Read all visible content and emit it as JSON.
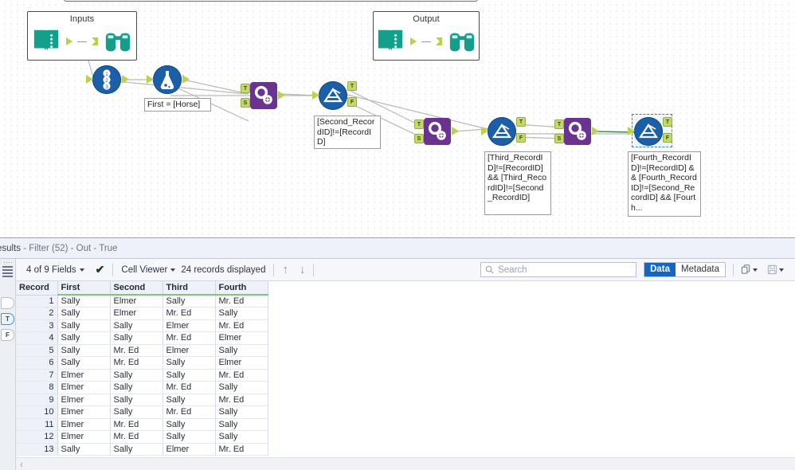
{
  "canvas": {
    "containers": [
      {
        "title": "Inputs"
      },
      {
        "title": "Output"
      }
    ],
    "expressions": [
      "First = [Horse]",
      "[Second_RecordID]!=[RecordID]",
      "[Third_RecordID]!=[RecordID] && [Third_RecordID]!=[Second_RecordID]",
      "[Fourth_RecordID]!=[RecordID] && [Fourth_RecordID]!=[Second_RecordID] && [Fourth..."
    ],
    "anchors": {
      "true": "T",
      "false": "F",
      "source": "S"
    }
  },
  "results": {
    "title_prefix": "esults",
    "title_rest": " - Filter (52) - Out - True",
    "toolbar": {
      "fields": "4 of 9 Fields",
      "cell_viewer": "Cell Viewer",
      "records": "24 records displayed",
      "search_placeholder": "Search",
      "data_label": "Data",
      "metadata_label": "Metadata",
      "up_arrow": "↑",
      "down_arrow": "↓",
      "check": "✔"
    },
    "rail": {
      "true_tab": "T",
      "false_tab": "F"
    },
    "table": {
      "columns": [
        "Record",
        "First",
        "Second",
        "Third",
        "Fourth"
      ],
      "rows": [
        [
          "1",
          "Sally",
          "Elmer",
          "Sally",
          "Mr. Ed"
        ],
        [
          "2",
          "Sally",
          "Elmer",
          "Mr. Ed",
          "Sally"
        ],
        [
          "3",
          "Sally",
          "Sally",
          "Elmer",
          "Mr. Ed"
        ],
        [
          "4",
          "Sally",
          "Sally",
          "Mr. Ed",
          "Elmer"
        ],
        [
          "5",
          "Sally",
          "Mr. Ed",
          "Elmer",
          "Sally"
        ],
        [
          "6",
          "Sally",
          "Mr. Ed",
          "Sally",
          "Elmer"
        ],
        [
          "7",
          "Elmer",
          "Sally",
          "Sally",
          "Mr. Ed"
        ],
        [
          "8",
          "Elmer",
          "Sally",
          "Mr. Ed",
          "Sally"
        ],
        [
          "9",
          "Elmer",
          "Sally",
          "Sally",
          "Mr. Ed"
        ],
        [
          "10",
          "Elmer",
          "Sally",
          "Mr. Ed",
          "Sally"
        ],
        [
          "11",
          "Elmer",
          "Mr. Ed",
          "Sally",
          "Sally"
        ],
        [
          "12",
          "Elmer",
          "Mr. Ed",
          "Sally",
          "Sally"
        ],
        [
          "13",
          "Sally",
          "Sally",
          "Elmer",
          "Mr. Ed"
        ]
      ]
    }
  },
  "colors": {
    "node_blue": "#1a5fa8",
    "node_purple": "#69338f",
    "teal": "#12a08a",
    "anchor_green": "#b9d24f",
    "active_blue": "#1566c0",
    "selection_blue": "#3b7fd4",
    "wire_green": "#1e9e4a"
  }
}
